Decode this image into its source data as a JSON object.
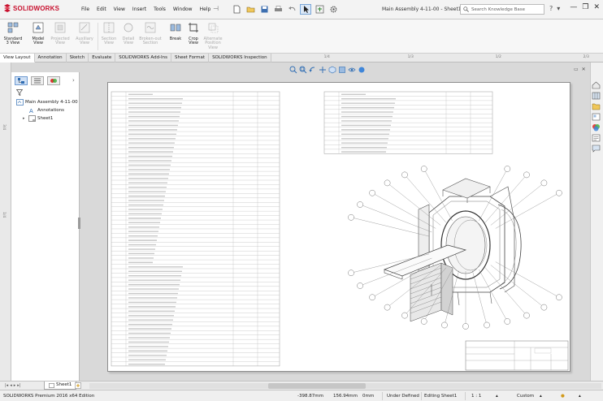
{
  "app": {
    "brand": "SOLIDWORKS",
    "document_title": "Main Assembly 4-11-00 - Sheet1"
  },
  "menu": [
    "File",
    "Edit",
    "View",
    "Insert",
    "Tools",
    "Window",
    "Help"
  ],
  "search": {
    "placeholder": "Search Knowledge Base"
  },
  "help_glyph": "?",
  "ribbon": [
    {
      "label_1": "Standard",
      "label_2": "3 View",
      "enabled": true
    },
    {
      "label_1": "Model",
      "label_2": "View",
      "enabled": true
    },
    {
      "label_1": "Projected",
      "label_2": "View",
      "enabled": false
    },
    {
      "label_1": "Auxiliary",
      "label_2": "View",
      "enabled": false
    },
    {
      "label_1": "Section",
      "label_2": "View",
      "enabled": false
    },
    {
      "label_1": "Detail",
      "label_2": "View",
      "enabled": false
    },
    {
      "label_1": "Broken-out",
      "label_2": "Section",
      "enabled": false
    },
    {
      "label_1": "Break",
      "label_2": "",
      "enabled": true
    },
    {
      "label_1": "Crop",
      "label_2": "View",
      "enabled": true
    },
    {
      "label_1": "Alternate",
      "label_2": "Position View",
      "enabled": false
    }
  ],
  "tabs": [
    "View Layout",
    "Annotation",
    "Sketch",
    "Evaluate",
    "SOLIDWORKS Add-Ins",
    "Sheet Format",
    "SOLIDWORKS Inspection"
  ],
  "ruler_top": [
    "1/4",
    "1/3",
    "1/2",
    "2/3"
  ],
  "ruler_left": [
    "3/4",
    "1/4"
  ],
  "feature_tree": {
    "root": "Main Assembly 4-11-00",
    "children": [
      "Annotations",
      "Sheet1"
    ]
  },
  "sheet_tabs": [
    "Sheet1"
  ],
  "status": {
    "edition": "SOLIDWORKS Premium 2016 x64 Edition",
    "x": "-398.87mm",
    "y": "156.94mm",
    "z": "0mm",
    "state": "Under Defined",
    "mode": "Editing Sheet1",
    "scale": "1 : 1",
    "units": "Custom"
  },
  "colors": {
    "brand": "#c8102e",
    "accent": "#2f6db3",
    "sheet": "#ffffff",
    "canvas": "#d9d9d9"
  }
}
